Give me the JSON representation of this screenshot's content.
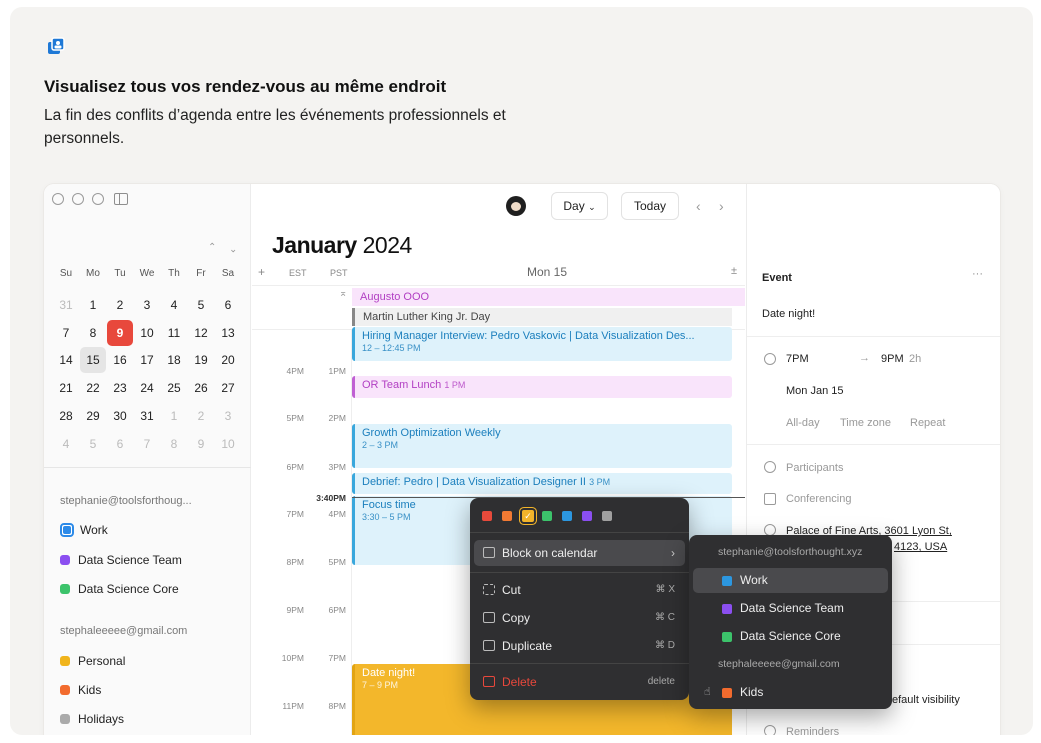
{
  "header": {
    "headline": "Visualisez tous vos rendez-vous au même endroit",
    "subline": "La fin des conflits d’agenda entre les événements professionnels et personnels."
  },
  "calendar": {
    "month_name": "January",
    "year": "2024",
    "weekdays": [
      "Su",
      "Mo",
      "Tu",
      "We",
      "Th",
      "Fr",
      "Sa"
    ],
    "weeks": [
      [
        "31",
        "1",
        "2",
        "3",
        "4",
        "5",
        "6"
      ],
      [
        "7",
        "8",
        "9",
        "10",
        "11",
        "12",
        "13"
      ],
      [
        "14",
        "15",
        "16",
        "17",
        "18",
        "19",
        "20"
      ],
      [
        "21",
        "22",
        "23",
        "24",
        "25",
        "26",
        "27"
      ],
      [
        "28",
        "29",
        "30",
        "31",
        "1",
        "2",
        "3"
      ],
      [
        "4",
        "5",
        "6",
        "7",
        "8",
        "9",
        "10"
      ]
    ],
    "today": "9",
    "selected": "15"
  },
  "sidebar": {
    "account1": "stephanie@toolsforthoug...",
    "calendars1": [
      {
        "name": "Work",
        "color": "#2c8ae8"
      },
      {
        "name": "Data Science Team",
        "color": "#8b4ff0"
      },
      {
        "name": "Data Science Core",
        "color": "#3cc36b"
      }
    ],
    "account2": "stephaleeeee@gmail.com",
    "calendars2": [
      {
        "name": "Personal",
        "color": "#f0b41c"
      },
      {
        "name": "Kids",
        "color": "#f26b2e"
      },
      {
        "name": "Holidays",
        "color": "#aaaaaa"
      }
    ]
  },
  "toolbar": {
    "view": "Day",
    "today": "Today"
  },
  "dayview": {
    "add": "+",
    "tz1": "EST",
    "tz2": "PST",
    "day_header": "Mon 15",
    "collapse": "±",
    "allday": [
      "Augusto OOO",
      "Martin Luther King Jr. Day"
    ],
    "times_est": [
      "4PM",
      "5PM",
      "6PM",
      "3:40PM",
      "7PM",
      "8PM",
      "9PM",
      "10PM",
      "11PM"
    ],
    "times_pst": [
      "1PM",
      "2PM",
      "3PM",
      "4PM",
      "5PM",
      "6PM",
      "7PM",
      "8PM"
    ],
    "events": [
      {
        "title": "Hiring Manager Interview: Pedro Vaskovic | Data Visualization Des...",
        "time": "12 – 12:45 PM"
      },
      {
        "title": "OR Team Lunch",
        "time": "1 PM"
      },
      {
        "title": "Growth Optimization Weekly",
        "time": "2 – 3 PM"
      },
      {
        "title": "Debrief: Pedro | Data Visualization Designer II",
        "time": "3 PM"
      },
      {
        "title": "Focus time",
        "time": "3:30 – 5 PM"
      },
      {
        "title": "Date night!",
        "time": "7 – 9 PM"
      }
    ]
  },
  "event_panel": {
    "label": "Event",
    "more": "···",
    "title": "Date night!",
    "start": "7PM",
    "end": "9PM",
    "duration": "2h",
    "date": "Mon Jan 15",
    "allday": "All-day",
    "timezone": "Time zone",
    "repeat": "Repeat",
    "participants": "Participants",
    "conferencing": "Conferencing",
    "location_1": "Palace of Fine Arts, 3601 Lyon St,",
    "location_2": "4123, USA",
    "visibility": "efault visibility",
    "reminders": "Reminders"
  },
  "context_menu": {
    "colors": [
      "#e84a3b",
      "#f27a33",
      "#f2b42a",
      "#3cc36b",
      "#2c97e0",
      "#8b4ff0",
      "#a0a0a0"
    ],
    "block": "Block on calendar",
    "cut": "Cut",
    "cut_kb": "⌘ X",
    "copy": "Copy",
    "copy_kb": "⌘ C",
    "duplicate": "Duplicate",
    "duplicate_kb": "⌘ D",
    "delete": "Delete",
    "delete_kb": "delete"
  },
  "submenu": {
    "account1": "stephanie@toolsforthought.xyz",
    "items1": [
      {
        "name": "Work",
        "color": "#2c97e0"
      },
      {
        "name": "Data Science Team",
        "color": "#8b4ff0"
      },
      {
        "name": "Data Science Core",
        "color": "#3cc36b"
      }
    ],
    "account2": "stephaleeeee@gmail.com",
    "items2": [
      {
        "name": "Kids",
        "color": "#f26b2e"
      }
    ]
  }
}
